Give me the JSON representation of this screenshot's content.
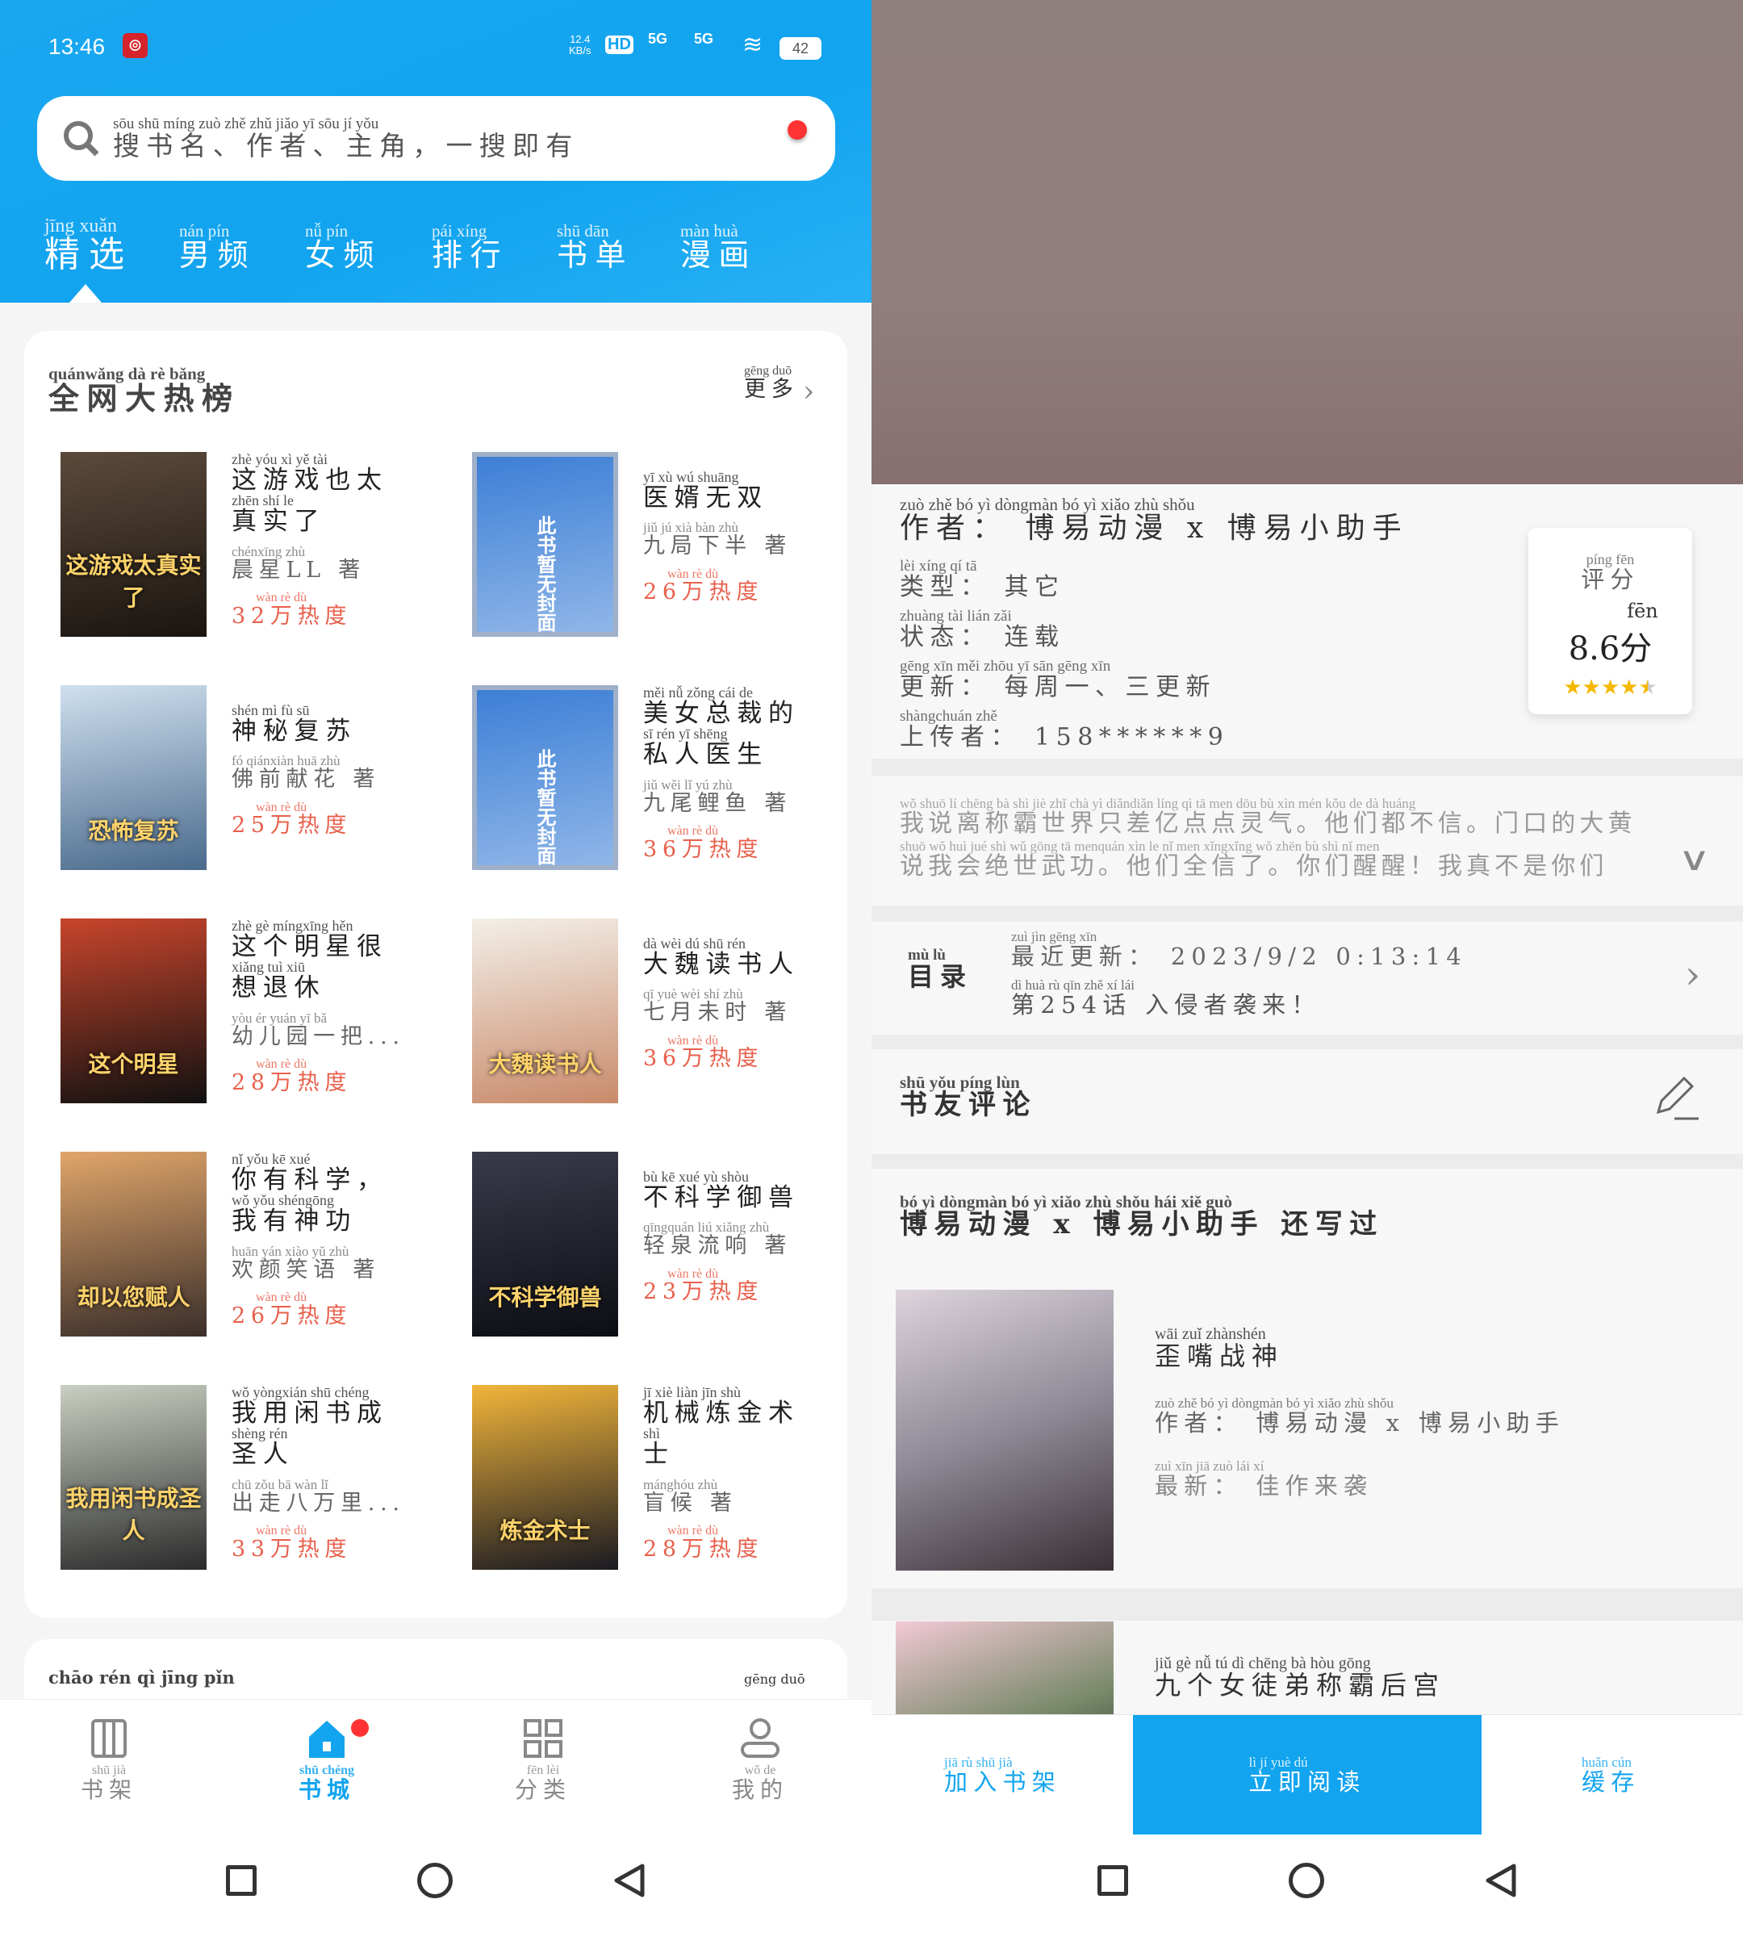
{
  "status": {
    "time": "13:46",
    "net_speed": "12.4",
    "net_unit": "KB/s",
    "hd": "HD",
    "sim1": "5G",
    "sim2": "5G",
    "battery": "42"
  },
  "search": {
    "py": "sōu shū míng   zuò zhě   zhǔ jiǎo   yī sōu jí yǒu",
    "zh": "搜书名、作者、主角，一搜即有"
  },
  "tabs": [
    {
      "py": "jīng xuǎn",
      "zh": "精选"
    },
    {
      "py": "nán pín",
      "zh": "男频"
    },
    {
      "py": "nǚ pín",
      "zh": "女频"
    },
    {
      "py": "pái xíng",
      "zh": "排行"
    },
    {
      "py": "shū dān",
      "zh": "书单"
    },
    {
      "py": "màn huà",
      "zh": "漫画"
    }
  ],
  "section": {
    "title": {
      "py": "quánwǎng dà rè bǎng",
      "zh": "全网大热榜"
    },
    "more": {
      "py": "gēng duō",
      "zh": "更多"
    }
  },
  "books": [
    {
      "cover_text": "这游戏太真实了",
      "cover": [
        "#5b4a3a",
        "#1a1410"
      ],
      "title": [
        {
          "py": "zhè yóu xì yě tài",
          "zh": "这游戏也太"
        },
        {
          "py": "zhēn shí le",
          "zh": "真实了"
        }
      ],
      "author": {
        "py": "chénxīng       zhù",
        "zh": "晨星LL 著"
      },
      "heat": {
        "py": "wàn rè dù",
        "zh": "32万热度"
      }
    },
    {
      "cover_text": "此书暂无封面",
      "cover": [
        "#3d7fd6",
        "#8fb6e8"
      ],
      "title": [
        {
          "py": "yī xù wú shuāng",
          "zh": "医婿无双"
        }
      ],
      "author": {
        "py": "jiǔ jú xià bàn zhù",
        "zh": "九局下半 著"
      },
      "heat": {
        "py": "wàn rè dù",
        "zh": "26万热度"
      }
    },
    {
      "cover_text": "恐怖复苏",
      "cover": [
        "#cfe0ef",
        "#4a6a8c"
      ],
      "title": [
        {
          "py": "shén mì fù sū",
          "zh": "神秘复苏"
        }
      ],
      "author": {
        "py": "fó qiánxiàn huā zhù",
        "zh": "佛前献花 著"
      },
      "heat": {
        "py": "wàn rè dù",
        "zh": "25万热度"
      }
    },
    {
      "cover_text": "此书暂无封面",
      "cover": [
        "#3d7fd6",
        "#8fb6e8"
      ],
      "title": [
        {
          "py": "měi nǚ zǒng cái de",
          "zh": "美女总裁的"
        },
        {
          "py": "sī rén yī shēng",
          "zh": "私人医生"
        }
      ],
      "author": {
        "py": "jiǔ wěi lǐ yú zhù",
        "zh": "九尾鲤鱼 著"
      },
      "heat": {
        "py": "wàn rè dù",
        "zh": "36万热度"
      }
    },
    {
      "cover_text": "这个明星",
      "cover": [
        "#c8452c",
        "#111"
      ],
      "title": [
        {
          "py": "zhè gè míngxīng hěn",
          "zh": "这个明星很"
        },
        {
          "py": "xiǎng tuì xiū",
          "zh": "想退休"
        }
      ],
      "author": {
        "py": "yòu ér yuán yī bǎ",
        "zh": "幼儿园一把..."
      },
      "heat": {
        "py": "wàn rè dù",
        "zh": "28万热度"
      }
    },
    {
      "cover_text": "大魏读书人",
      "cover": [
        "#f3efe8",
        "#c98a6a"
      ],
      "title": [
        {
          "py": "dà wèi dú shū rén",
          "zh": "大魏读书人"
        }
      ],
      "author": {
        "py": "qī yuè wèi shí zhù",
        "zh": "七月未时 著"
      },
      "heat": {
        "py": "wàn rè dù",
        "zh": "36万热度"
      }
    },
    {
      "cover_text": "却以您赋人",
      "cover": [
        "#e0a56a",
        "#3a2e2a"
      ],
      "title": [
        {
          "py": "nǐ yǒu kē xué",
          "zh": "你有科学，"
        },
        {
          "py": "wǒ yǒu shéngōng",
          "zh": "我有神功"
        }
      ],
      "author": {
        "py": "huān yán xiào yǔ zhù",
        "zh": "欢颜笑语 著"
      },
      "heat": {
        "py": "wàn rè dù",
        "zh": "26万热度"
      }
    },
    {
      "cover_text": "不科学御兽",
      "cover": [
        "#3a3a4a",
        "#0d0d14"
      ],
      "title": [
        {
          "py": "bù kē xué yù shòu",
          "zh": "不科学御兽"
        }
      ],
      "author": {
        "py": "qīngquán liú xiǎng zhù",
        "zh": "轻泉流响 著"
      },
      "heat": {
        "py": "wàn rè dù",
        "zh": "23万热度"
      }
    },
    {
      "cover_text": "我用闲书成圣人",
      "cover": [
        "#c9cfc2",
        "#2b2b2b"
      ],
      "title": [
        {
          "py": "wǒ yòngxián shū chéng",
          "zh": "我用闲书成"
        },
        {
          "py": "shèng rén",
          "zh": "圣人"
        }
      ],
      "author": {
        "py": "chū zǒu bā wàn lǐ",
        "zh": "出走八万里..."
      },
      "heat": {
        "py": "wàn rè dù",
        "zh": "33万热度"
      }
    },
    {
      "cover_text": "炼金术士",
      "cover": [
        "#f2b53a",
        "#1a1a22"
      ],
      "title": [
        {
          "py": "jī xiè liàn jīn shù",
          "zh": "机械炼金术"
        },
        {
          "py": "shì",
          "zh": "士"
        }
      ],
      "author": {
        "py": "mánghóu zhù",
        "zh": "盲候 著"
      },
      "heat": {
        "py": "wàn rè dù",
        "zh": "28万热度"
      }
    }
  ],
  "section2": {
    "title": {
      "py": "chāo rén qì jīng pǐn",
      "zh": ""
    },
    "more": {
      "py": "gēng duō",
      "zh": ""
    }
  },
  "nav": [
    {
      "py": "shū jià",
      "zh": "书架",
      "icon": "bookshelf-icon"
    },
    {
      "py": "shū chéng",
      "zh": "书城",
      "icon": "home-icon",
      "active": true
    },
    {
      "py": "fēn lèi",
      "zh": "分类",
      "icon": "grid-icon"
    },
    {
      "py": "wǒ de",
      "zh": "我的",
      "icon": "person-icon"
    }
  ],
  "detail": {
    "author": {
      "py": "zuò zhě     bó yì dòngmàn   bó yì xiǎo zhù shǒu",
      "zh": "作者： 博易动漫 x 博易小助手"
    },
    "type": {
      "py": "lèi xíng   qí tā",
      "zh": "类型： 其它"
    },
    "state": {
      "py": "zhuàng tài  lián zǎi",
      "zh": "状态： 连载"
    },
    "update": {
      "py": "gēng xīn   měi zhōu yī   sān gēng xīn",
      "zh": "更新： 每周一、三更新"
    },
    "uploader": {
      "py": "shàngchuán zhě",
      "zh": "上传者： 158******9"
    },
    "rating": {
      "label": {
        "py": "píng fēn",
        "zh": "评分"
      },
      "unit_py": "fēn",
      "value": "8.6分",
      "stars": 4.5,
      "star_color": "#f5b800"
    },
    "synopsis": {
      "py1": "wǒ shuō lí chēng bà shì jiè zhǐ chà yì diǎndiǎn líng qì   tā men dōu bù xìn   mén kǒu de dà huáng",
      "zh1": "我说离称霸世界只差亿点点灵气。他们都不信。门口的大黄",
      "py2": "shuō wǒ huì jué shì wǔ gōng   tā menquán xìn le   nǐ men xǐngxǐng   wǒ zhēn bù shì nǐ men",
      "zh2": "说我会绝世武功。他们全信了。你们醒醒！我真不是你们"
    },
    "catalog": {
      "label": {
        "py": "mù lù",
        "zh": "目录"
      },
      "latest": {
        "py": "zuì jìn gēng xīn",
        "zh": "最近更新： 2023/9/2 0:13:14"
      },
      "chapter": {
        "py": "dì          huà  rù qīn zhě xí lái",
        "zh": "第254话 入侵者袭来！"
      }
    },
    "reviews": {
      "py": "shū yǒu píng lùn",
      "zh": "书友评论"
    },
    "also": {
      "py": "bó yì dòngmàn   bó yì xiǎo zhù shǒu  hái xiě guò",
      "zh": "博易动漫 x 博易小助手 还写过"
    },
    "other_books": [
      {
        "title": {
          "py": "wāi zuǐ zhànshén",
          "zh": "歪嘴战神"
        },
        "author": {
          "py": "zuò zhě   bó yì dòngmàn   bó yì xiǎo zhù shǒu",
          "zh": "作者： 博易动漫 x 博易小助手"
        },
        "latest": {
          "py": "zuì xīn    jiā zuò lái xí",
          "zh": "最新： 佳作来袭"
        }
      },
      {
        "title": {
          "py": "jiǔ gè nǚ tú dì chēng bà hòu gōng",
          "zh": "九个女徒弟称霸后宫"
        }
      }
    ],
    "actions": {
      "shelf": {
        "py": "jiā rù shū jià",
        "zh": "加入书架"
      },
      "read": {
        "py": "lì jí yuè dú",
        "zh": "立即阅读"
      },
      "cache": {
        "py": "huǎn cún",
        "zh": "缓存"
      }
    },
    "accent": "#12a4ef"
  }
}
